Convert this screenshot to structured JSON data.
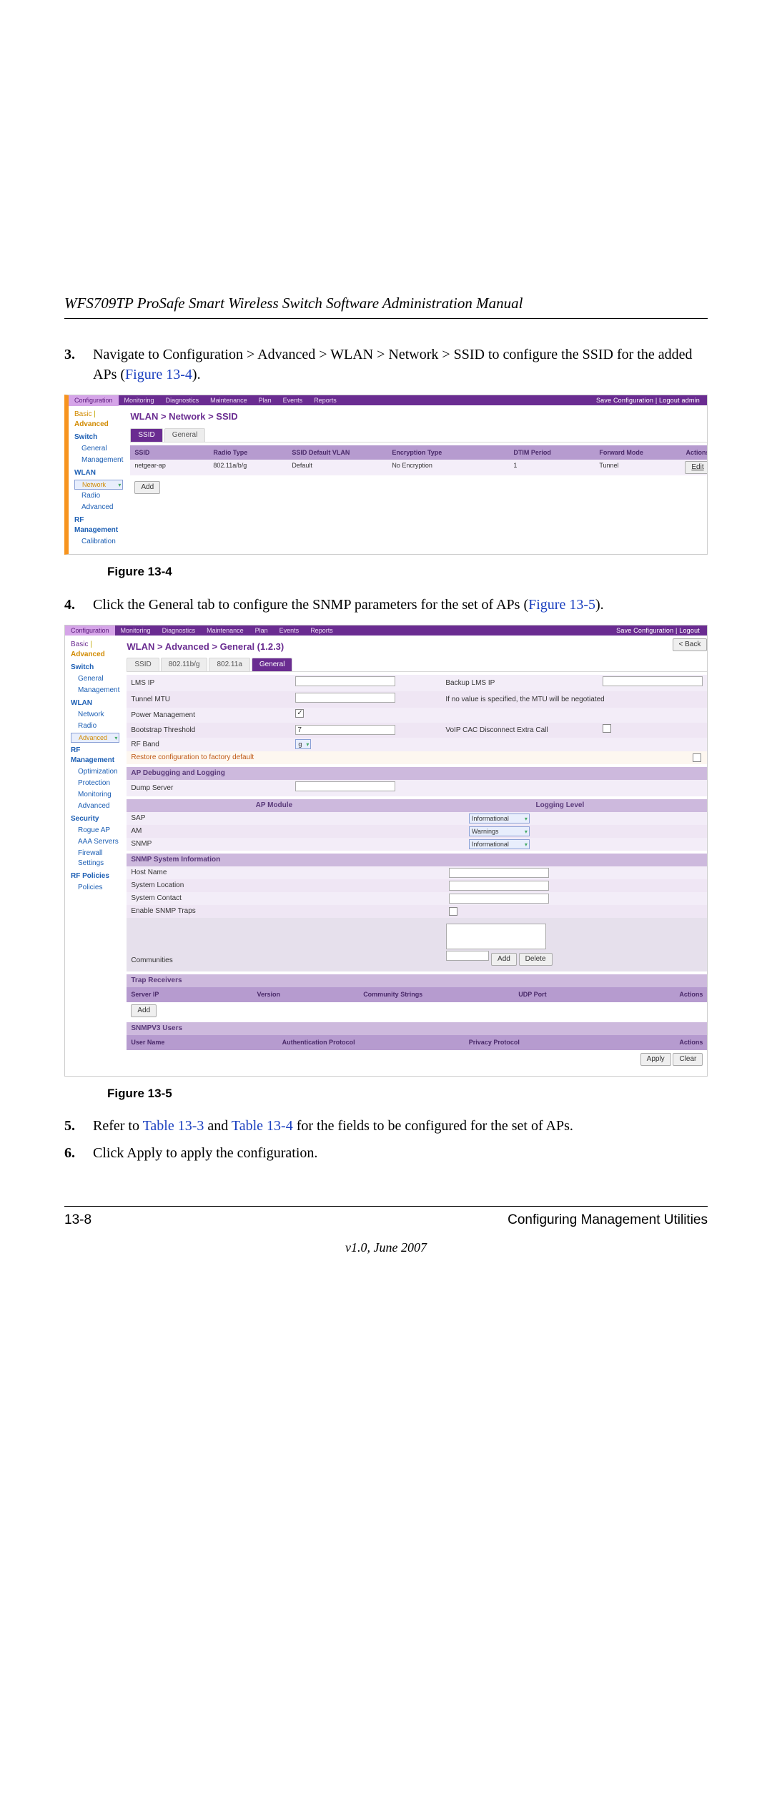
{
  "doc_title": "WFS709TP ProSafe Smart Wireless Switch Software Administration Manual",
  "step3": {
    "num": "3.",
    "text_before": "Navigate to Configuration > Advanced > WLAN > Network > SSID to configure the SSID for the added APs (",
    "link": "Figure 13-4",
    "text_after": ")."
  },
  "fig4": {
    "caption": "Figure 13-4",
    "topbar": {
      "tabs": [
        "Configuration",
        "Monitoring",
        "Diagnostics",
        "Maintenance",
        "Plan",
        "Events",
        "Reports"
      ],
      "active_idx": 0,
      "right": "Save Configuration  |  Logout admin"
    },
    "side": {
      "top_basic": "Basic",
      "top_adv": "Advanced",
      "groups": [
        {
          "title": "Switch",
          "items": [
            "General",
            "Management"
          ]
        },
        {
          "title": "WLAN",
          "items": [
            "Network",
            "Radio",
            "Advanced"
          ],
          "selected": "Network"
        },
        {
          "title": "RF Management",
          "items": [
            "Calibration"
          ]
        }
      ]
    },
    "breadcrumb": "WLAN > Network > SSID",
    "subtabs": [
      "SSID",
      "General"
    ],
    "subtab_active": 0,
    "table": {
      "headers": [
        "SSID",
        "Radio Type",
        "SSID Default VLAN",
        "Encryption Type",
        "DTIM Period",
        "Forward Mode",
        "Actions"
      ],
      "row": [
        "netgear-ap",
        "802.11a/b/g",
        "Default",
        "No Encryption",
        "1",
        "Tunnel",
        "Edit"
      ]
    },
    "add_btn": "Add"
  },
  "step4": {
    "num": "4.",
    "text_before": "Click the General tab to configure the SNMP parameters for the set of APs (",
    "link": "Figure 13-5",
    "text_after": ")."
  },
  "fig5": {
    "caption": "Figure 13-5",
    "topbar": {
      "tabs": [
        "Configuration",
        "Monitoring",
        "Diagnostics",
        "Maintenance",
        "Plan",
        "Events",
        "Reports"
      ],
      "active_idx": 0,
      "right": "Save Configuration  |  Logout"
    },
    "back_btn": "< Back",
    "side": {
      "top_basic": "Basic",
      "top_adv": "Advanced",
      "groups": [
        {
          "title": "Switch",
          "items": [
            "General",
            "Management"
          ]
        },
        {
          "title": "WLAN",
          "items": [
            "Network",
            "Radio",
            "Advanced"
          ],
          "selected": "Advanced"
        },
        {
          "title": "RF Management",
          "items": [
            "Optimization",
            "Protection",
            "Monitoring",
            "Advanced"
          ]
        },
        {
          "title": "Security",
          "items": [
            "Rogue AP",
            "AAA Servers",
            "Firewall Settings"
          ]
        },
        {
          "title": "RF Policies",
          "items": [
            "Policies"
          ]
        }
      ]
    },
    "breadcrumb": "WLAN > Advanced > General (1.2.3)",
    "subtabs": [
      "SSID",
      "802.11b/g",
      "802.11a",
      "General"
    ],
    "subtab_active": 3,
    "rows_top": [
      {
        "l": "LMS IP",
        "r": "Backup LMS IP"
      },
      {
        "l": "Tunnel MTU",
        "r": "If no value is specified, the MTU will be negotiated"
      },
      {
        "l": "Power Management",
        "type": "chk_left",
        "r": ""
      },
      {
        "l": "Bootstrap Threshold",
        "val": "7",
        "r": "VoIP CAC Disconnect Extra Call",
        "type": "chk_right"
      },
      {
        "l": "RF Band",
        "type": "sel",
        "val": "g"
      }
    ],
    "restore_link": "Restore configuration to factory default",
    "sec_apdbg": "AP Debugging and Logging",
    "dump_server": "Dump Server",
    "module_hdr_left": "AP Module",
    "module_hdr_right": "Logging Level",
    "modules": [
      {
        "name": "SAP",
        "level": "Informational"
      },
      {
        "name": "AM",
        "level": "Warnings"
      },
      {
        "name": "SNMP",
        "level": "Informational"
      }
    ],
    "sec_snmp": "SNMP System Information",
    "snmp_rows": [
      "Host Name",
      "System Location",
      "System Contact",
      "Enable SNMP Traps"
    ],
    "communities": "Communities",
    "add_btn": "Add",
    "delete_btn": "Delete",
    "sec_trap": "Trap Receivers",
    "trap_headers": [
      "Server IP",
      "Version",
      "Community Strings",
      "UDP Port",
      "Actions"
    ],
    "sec_snmpv3": "SNMPV3 Users",
    "v3_headers": [
      "User Name",
      "Authentication Protocol",
      "Privacy Protocol",
      "Actions"
    ],
    "apply": "Apply",
    "clear": "Clear"
  },
  "step5": {
    "num": "5.",
    "text_before": "Refer to ",
    "link1": "Table 13-3",
    "mid": " and ",
    "link2": "Table 13-4",
    "text_after": " for the fields to be configured for the set of APs."
  },
  "step6": {
    "num": "6.",
    "text": "Click Apply to apply the configuration."
  },
  "footer": {
    "page": "13-8",
    "section": "Configuring Management Utilities",
    "version": "v1.0, June 2007"
  }
}
